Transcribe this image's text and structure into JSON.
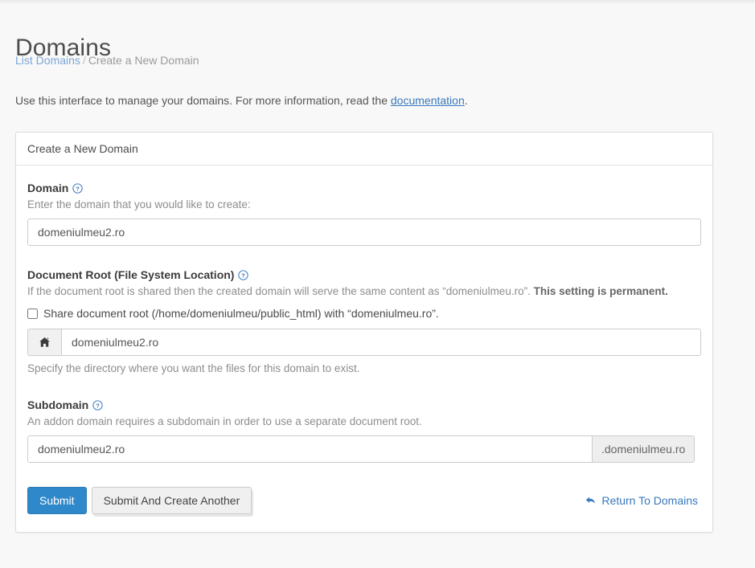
{
  "page": {
    "title": "Domains",
    "breadcrumb": {
      "link_label": "List Domains",
      "separator": "/",
      "current_label": "Create a New Domain"
    },
    "intro": {
      "before": "Use this interface to manage your domains. For more information, read the ",
      "link_label": "documentation",
      "after": "."
    }
  },
  "panel": {
    "heading": "Create a New Domain",
    "domain_field": {
      "label": "Domain",
      "help_icon": "question-circle-icon",
      "description": "Enter the domain that you would like to create:",
      "value": "domeniulmeu2.ro",
      "placeholder": ""
    },
    "document_root_field": {
      "label": "Document Root (File System Location)",
      "help_icon": "question-circle-icon",
      "description_normal": "If the document root is shared then the created domain will serve the same content as “domeniulmeu.ro”. ",
      "description_bold": "This setting is permanent.",
      "checkbox_label": "Share document root (/home/domeniulmeu/public_html) with “domeniulmeu.ro”.",
      "checkbox_checked": false,
      "addon_icon": "home-icon",
      "value": "domeniulmeu2.ro",
      "placeholder": "",
      "sub_help": "Specify the directory where you want the files for this domain to exist."
    },
    "subdomain_field": {
      "label": "Subdomain",
      "help_icon": "question-circle-icon",
      "description": "An addon domain requires a subdomain in order to use a separate document root.",
      "value": "domeniulmeu2.ro",
      "placeholder": "",
      "suffix": ".domeniulmeu.ro"
    },
    "actions": {
      "submit_label": "Submit",
      "submit_and_create_label": "Submit And Create Another",
      "return_link_label": "Return To Domains",
      "return_icon": "arrow-back-icon"
    }
  },
  "colors": {
    "primary": "#2f88c9",
    "link": "#3a78bd",
    "breadcrumb_link": "#7ba7d7",
    "page_background": "#f8f8f8",
    "panel_background": "#ffffff",
    "border": "#dddddd",
    "muted_text": "#8d8d8d"
  }
}
